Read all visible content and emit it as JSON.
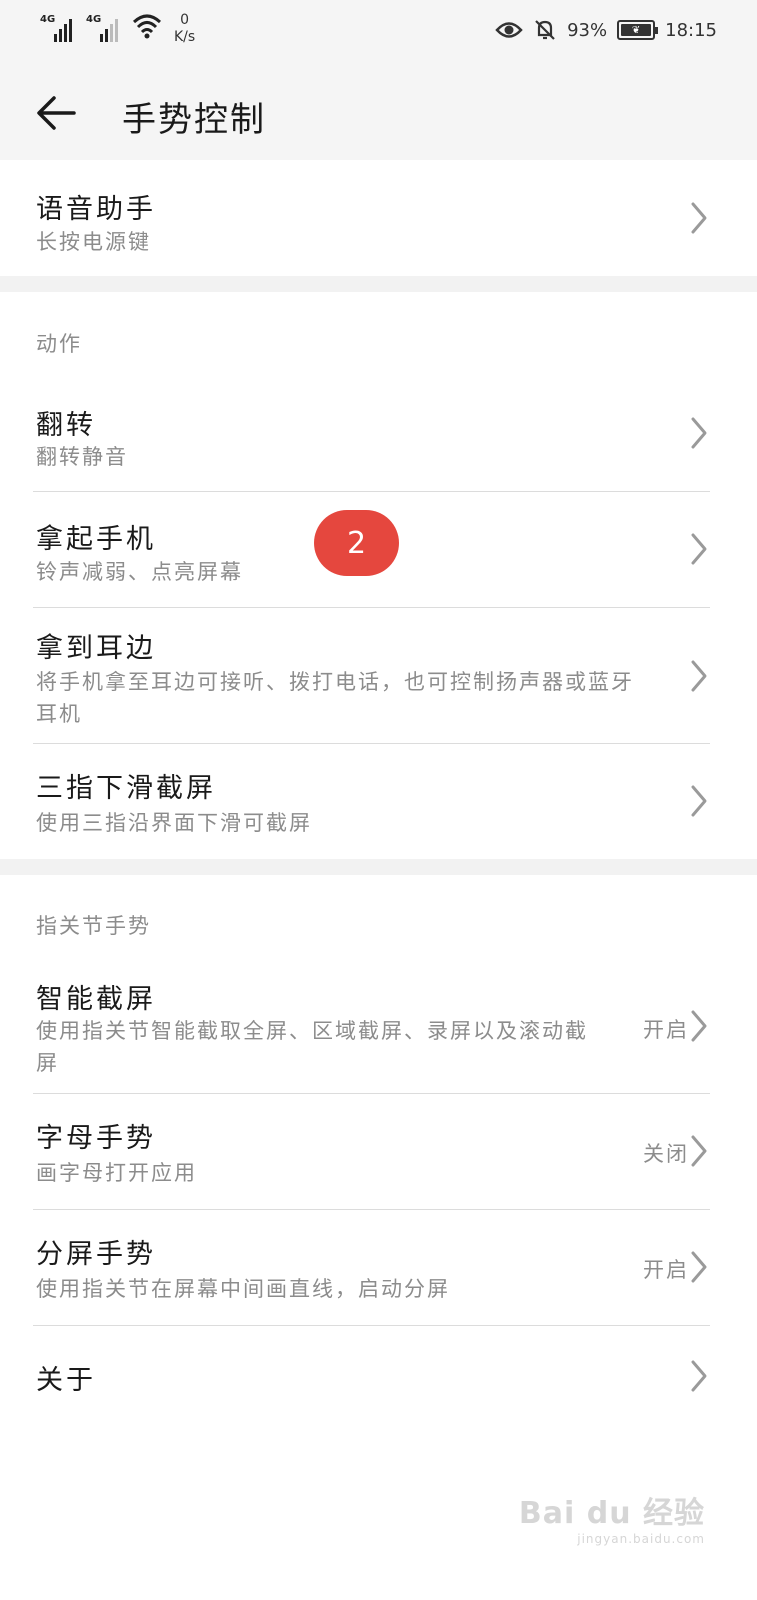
{
  "status_bar": {
    "sim1_label": "4G",
    "sim2_label": "4G",
    "speed_value": "0",
    "speed_unit": "K/s",
    "battery_percent": "93%",
    "time": "18:15"
  },
  "header": {
    "title": "手势控制"
  },
  "voice": {
    "title": "语音助手",
    "subtitle": "长按电源键"
  },
  "actions": {
    "header": "动作",
    "items": [
      {
        "title": "翻转",
        "subtitle": "翻转静音"
      },
      {
        "title": "拿起手机",
        "subtitle": "铃声减弱、点亮屏幕"
      },
      {
        "title": "拿到耳边",
        "subtitle": "将手机拿至耳边可接听、拨打电话，也可控制扬声器或蓝牙耳机"
      },
      {
        "title": "三指下滑截屏",
        "subtitle": "使用三指沿界面下滑可截屏"
      }
    ]
  },
  "knuckle": {
    "header": "指关节手势",
    "items": [
      {
        "title": "智能截屏",
        "subtitle": "使用指关节智能截取全屏、区域截屏、录屏以及滚动截屏",
        "value": "开启"
      },
      {
        "title": "字母手势",
        "subtitle": "画字母打开应用",
        "value": "关闭"
      },
      {
        "title": "分屏手势",
        "subtitle": "使用指关节在屏幕中间画直线，启动分屏",
        "value": "开启"
      }
    ]
  },
  "about": {
    "title": "关于"
  },
  "annotation": {
    "step": "2",
    "color": "#e5473e"
  },
  "watermark": {
    "line1": "Bai du 经验",
    "line2": "jingyan.baidu.com"
  }
}
